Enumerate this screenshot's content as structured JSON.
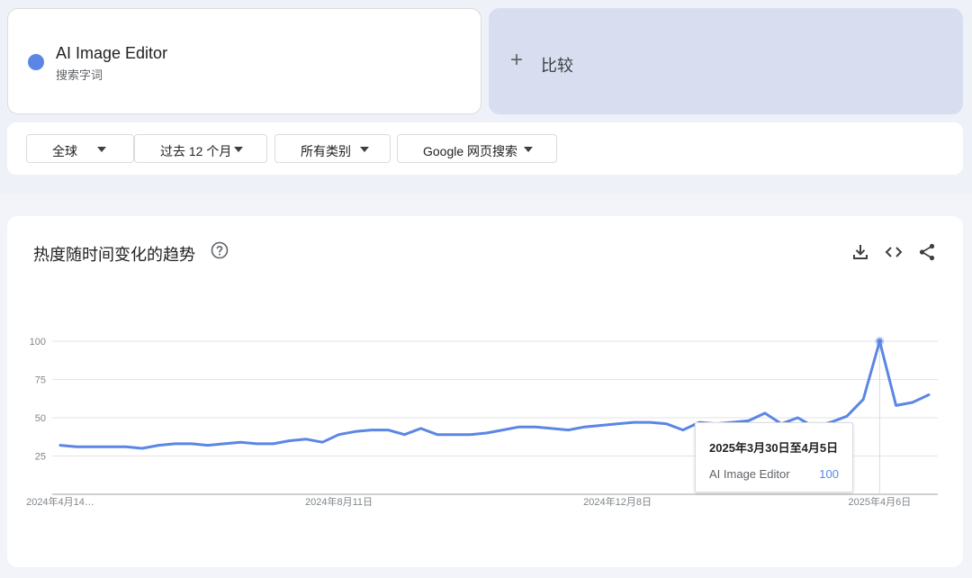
{
  "term": {
    "name": "AI Image Editor",
    "type": "搜索字词",
    "color": "#5b86e5"
  },
  "compare": {
    "plus": "+",
    "label": "比较"
  },
  "filters": [
    {
      "label": "全球"
    },
    {
      "label": "过去 12 个月"
    },
    {
      "label": "所有类别"
    },
    {
      "label": "Google 网页搜索"
    }
  ],
  "chart_section": {
    "title": "热度随时间变化的趋势",
    "help_icon": "help-circle-icon",
    "tools": [
      "download-icon",
      "embed-code-icon",
      "share-icon"
    ]
  },
  "tooltip": {
    "date": "2025年3月30日至4月5日",
    "term": "AI Image Editor",
    "value": "100"
  },
  "chart_data": {
    "type": "line",
    "x_tick_labels": [
      "2024年4月14…",
      "2024年8月11日",
      "2024年12月8日",
      "2025年4月6日"
    ],
    "x_tick_index": [
      0,
      17,
      34,
      50
    ],
    "ylim": [
      0,
      100
    ],
    "y_ticks": [
      25,
      50,
      75,
      100
    ],
    "grid": true,
    "series": [
      {
        "name": "AI Image Editor",
        "color": "#5b86e5",
        "values": [
          32,
          31,
          31,
          31,
          31,
          30,
          32,
          33,
          33,
          32,
          33,
          34,
          33,
          33,
          35,
          36,
          34,
          39,
          41,
          42,
          42,
          39,
          43,
          39,
          39,
          39,
          40,
          42,
          44,
          44,
          43,
          42,
          44,
          45,
          46,
          47,
          47,
          46,
          42,
          47,
          46,
          47,
          48,
          53,
          46,
          50,
          44,
          47,
          51,
          62,
          100,
          58,
          60,
          65
        ]
      }
    ],
    "highlight_index": 50
  }
}
